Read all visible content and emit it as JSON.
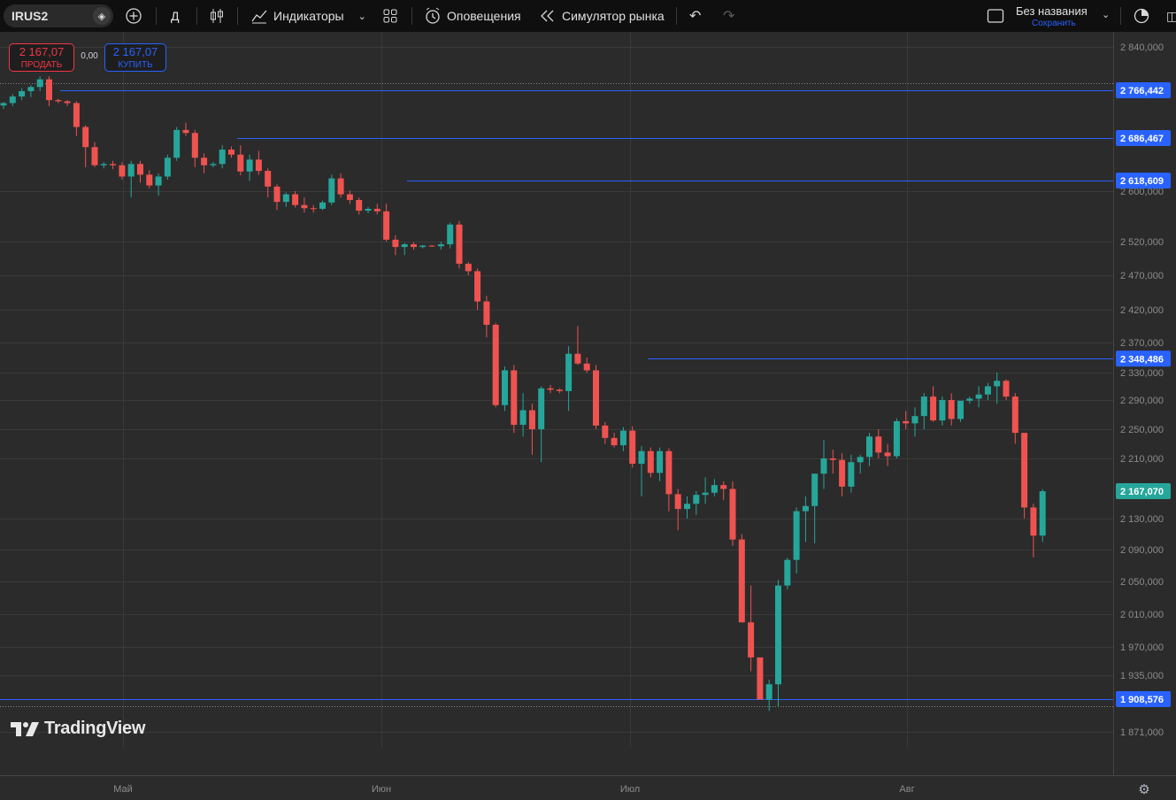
{
  "toolbar": {
    "symbol": "IRUS2",
    "interval": "Д",
    "indicators_label": "Индикаторы",
    "alerts_label": "Оповещения",
    "replay_label": "Симулятор рынка",
    "layout_name": "Без названия",
    "save_label": "Сохранить",
    "icons": [
      "symbol-search-icon",
      "add-symbol-icon",
      "candles-icon",
      "indicators-icon",
      "templates-icon",
      "alert-icon",
      "replay-icon",
      "undo-icon",
      "redo-icon",
      "layout-icon",
      "search-icon",
      "screenshot-icon"
    ]
  },
  "trade": {
    "sell_price": "2 167,07",
    "sell_label": "ПРОДАТЬ",
    "spread": "0,00",
    "buy_price": "2 167,07",
    "buy_label": "КУПИТЬ"
  },
  "logo_text": "TradingView",
  "colors": {
    "up": "#26a69a",
    "down": "#ef5350",
    "line": "#2962ff",
    "background": "#2b2b2b"
  },
  "chart_data": {
    "type": "candlestick",
    "symbol": "IRUS2",
    "interval": "1D",
    "y_axis_ticks": [
      "2 840,000",
      "2 600,000",
      "2 520,000",
      "2 470,000",
      "2 420,000",
      "2 370,000",
      "2 330,000",
      "2 290,000",
      "2 250,000",
      "2 210,000",
      "2 130,000",
      "2 090,000",
      "2 050,000",
      "2 010,000",
      "1 970,000",
      "1 935,000",
      "1 871,000"
    ],
    "y_tick_values": [
      2840,
      2600,
      2520,
      2470,
      2420,
      2370,
      2330,
      2290,
      2250,
      2210,
      2130,
      2090,
      2050,
      2010,
      1970,
      1935,
      1871
    ],
    "x_axis_labels": [
      "Май",
      "Июн",
      "Июл",
      "Авг"
    ],
    "x_label_indices": [
      9,
      29,
      49,
      71
    ],
    "horizontal_levels": [
      {
        "label": "2 766,442",
        "value": 2766.442
      },
      {
        "label": "2 686,467",
        "value": 2686.467
      },
      {
        "label": "2 618,609",
        "value": 2618.609
      },
      {
        "label": "2 348,486",
        "value": 2348.486
      },
      {
        "label": "1 908,576",
        "value": 1908.576
      }
    ],
    "last_price": {
      "label": "2 167,070",
      "value": 2167.07
    },
    "candles": [
      [
        2741,
        2747,
        2735,
        2745
      ],
      [
        2745,
        2760,
        2740,
        2756
      ],
      [
        2756,
        2770,
        2750,
        2765
      ],
      [
        2765,
        2775,
        2755,
        2772
      ],
      [
        2772,
        2790,
        2765,
        2785
      ],
      [
        2785,
        2790,
        2740,
        2750
      ],
      [
        2750,
        2752,
        2745,
        2748
      ],
      [
        2748,
        2750,
        2740,
        2745
      ],
      [
        2745,
        2748,
        2690,
        2705
      ],
      [
        2705,
        2708,
        2640,
        2672
      ],
      [
        2672,
        2680,
        2640,
        2643
      ],
      [
        2643,
        2648,
        2638,
        2645
      ],
      [
        2645,
        2650,
        2637,
        2643
      ],
      [
        2643,
        2648,
        2620,
        2625
      ],
      [
        2625,
        2650,
        2590,
        2645
      ],
      [
        2645,
        2650,
        2615,
        2628
      ],
      [
        2628,
        2635,
        2605,
        2610
      ],
      [
        2610,
        2630,
        2593,
        2625
      ],
      [
        2625,
        2660,
        2620,
        2655
      ],
      [
        2655,
        2705,
        2650,
        2700
      ],
      [
        2700,
        2712,
        2690,
        2695
      ],
      [
        2695,
        2700,
        2640,
        2655
      ],
      [
        2655,
        2662,
        2630,
        2643
      ],
      [
        2643,
        2648,
        2640,
        2645
      ],
      [
        2645,
        2675,
        2638,
        2668
      ],
      [
        2668,
        2673,
        2655,
        2660
      ],
      [
        2660,
        2675,
        2627,
        2633
      ],
      [
        2633,
        2660,
        2618,
        2652
      ],
      [
        2652,
        2666,
        2628,
        2634
      ],
      [
        2634,
        2638,
        2590,
        2608
      ],
      [
        2608,
        2612,
        2570,
        2583
      ],
      [
        2583,
        2598,
        2575,
        2595
      ],
      [
        2595,
        2600,
        2574,
        2578
      ],
      [
        2578,
        2590,
        2566,
        2573
      ],
      [
        2573,
        2578,
        2566,
        2572
      ],
      [
        2572,
        2585,
        2570,
        2582
      ],
      [
        2582,
        2628,
        2578,
        2622
      ],
      [
        2622,
        2630,
        2590,
        2595
      ],
      [
        2595,
        2601,
        2580,
        2586
      ],
      [
        2586,
        2590,
        2563,
        2569
      ],
      [
        2569,
        2575,
        2565,
        2572
      ],
      [
        2572,
        2580,
        2563,
        2568
      ],
      [
        2568,
        2580,
        2520,
        2523
      ],
      [
        2523,
        2530,
        2500,
        2512
      ],
      [
        2512,
        2518,
        2500,
        2516
      ],
      [
        2516,
        2519,
        2508,
        2512
      ],
      [
        2512,
        2515,
        2510,
        2514
      ],
      [
        2514,
        2515,
        2512,
        2513
      ],
      [
        2513,
        2520,
        2508,
        2516
      ],
      [
        2516,
        2550,
        2510,
        2547
      ],
      [
        2547,
        2553,
        2480,
        2487
      ],
      [
        2487,
        2490,
        2470,
        2476
      ],
      [
        2476,
        2480,
        2420,
        2432
      ],
      [
        2432,
        2440,
        2378,
        2397
      ],
      [
        2397,
        2400,
        2280,
        2283
      ],
      [
        2283,
        2338,
        2275,
        2333
      ],
      [
        2333,
        2340,
        2245,
        2256
      ],
      [
        2256,
        2300,
        2240,
        2276
      ],
      [
        2276,
        2285,
        2215,
        2250
      ],
      [
        2250,
        2310,
        2205,
        2307
      ],
      [
        2307,
        2312,
        2300,
        2305
      ],
      [
        2305,
        2307,
        2300,
        2303
      ],
      [
        2303,
        2365,
        2275,
        2355
      ],
      [
        2355,
        2395,
        2340,
        2342
      ],
      [
        2342,
        2350,
        2330,
        2333
      ],
      [
        2333,
        2340,
        2250,
        2255
      ],
      [
        2255,
        2260,
        2230,
        2238
      ],
      [
        2238,
        2245,
        2225,
        2228
      ],
      [
        2228,
        2253,
        2220,
        2248
      ],
      [
        2248,
        2254,
        2198,
        2203
      ],
      [
        2203,
        2227,
        2160,
        2220
      ],
      [
        2220,
        2225,
        2185,
        2191
      ],
      [
        2191,
        2225,
        2180,
        2220
      ],
      [
        2220,
        2224,
        2140,
        2163
      ],
      [
        2163,
        2170,
        2115,
        2143
      ],
      [
        2143,
        2160,
        2130,
        2150
      ],
      [
        2150,
        2167,
        2135,
        2162
      ],
      [
        2162,
        2185,
        2150,
        2165
      ],
      [
        2165,
        2183,
        2160,
        2175
      ],
      [
        2175,
        2180,
        2155,
        2170
      ],
      [
        2170,
        2180,
        2095,
        2103
      ],
      [
        2103,
        2110,
        2000,
        2000
      ],
      [
        2000,
        2045,
        1940,
        1957
      ],
      [
        1957,
        1957,
        1910,
        1908
      ],
      [
        1908,
        1930,
        1895,
        1925
      ],
      [
        1925,
        2052,
        1900,
        2045
      ],
      [
        2045,
        2080,
        2040,
        2077
      ],
      [
        2077,
        2145,
        2060,
        2140
      ],
      [
        2140,
        2160,
        2100,
        2147
      ],
      [
        2147,
        2180,
        2098,
        2190
      ],
      [
        2190,
        2235,
        2170,
        2210
      ],
      [
        2210,
        2222,
        2190,
        2208
      ],
      [
        2208,
        2217,
        2160,
        2173
      ],
      [
        2173,
        2215,
        2165,
        2205
      ],
      [
        2205,
        2215,
        2190,
        2212
      ],
      [
        2212,
        2245,
        2200,
        2240
      ],
      [
        2240,
        2250,
        2210,
        2218
      ],
      [
        2218,
        2230,
        2200,
        2213
      ],
      [
        2213,
        2265,
        2210,
        2261
      ],
      [
        2261,
        2275,
        2250,
        2258
      ],
      [
        2258,
        2280,
        2240,
        2268
      ],
      [
        2268,
        2300,
        2250,
        2295
      ],
      [
        2295,
        2310,
        2260,
        2262
      ],
      [
        2262,
        2295,
        2255,
        2290
      ],
      [
        2290,
        2300,
        2255,
        2264
      ],
      [
        2264,
        2285,
        2260,
        2289
      ],
      [
        2289,
        2295,
        2285,
        2292
      ],
      [
        2292,
        2310,
        2280,
        2298
      ],
      [
        2298,
        2315,
        2290,
        2310
      ],
      [
        2310,
        2330,
        2285,
        2318
      ],
      [
        2318,
        2320,
        2290,
        2295
      ],
      [
        2295,
        2300,
        2230,
        2245
      ],
      [
        2245,
        2240,
        2130,
        2145
      ],
      [
        2145,
        2150,
        2080,
        2108
      ],
      [
        2108,
        2170,
        2100,
        2167
      ]
    ]
  }
}
